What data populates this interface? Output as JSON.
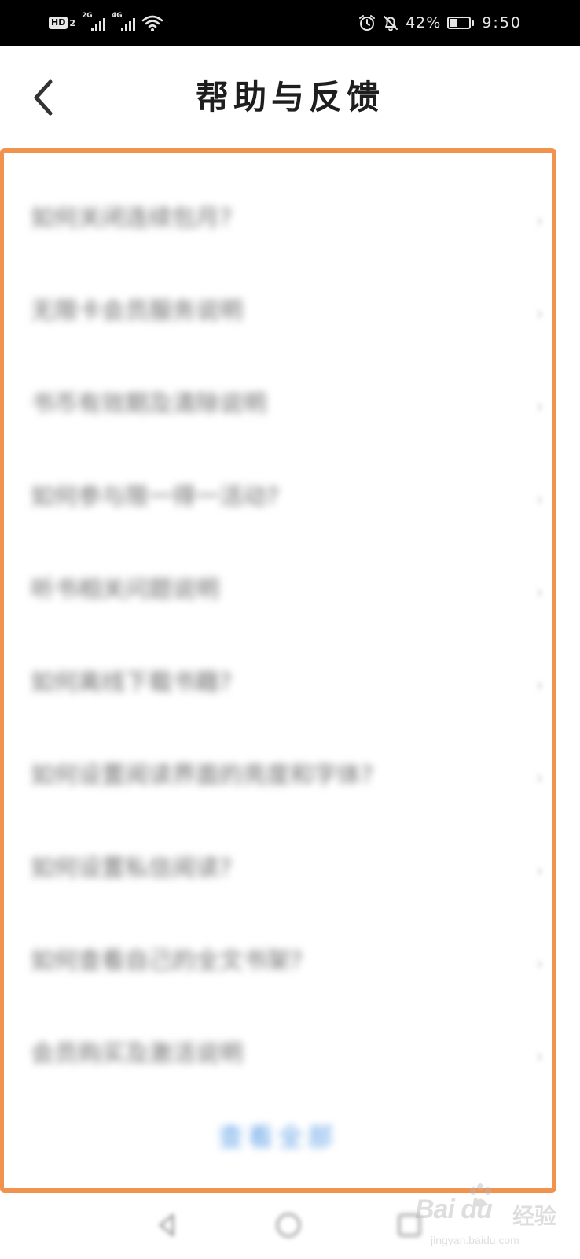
{
  "status_bar": {
    "hd_label": "HD",
    "hd_sub": "2",
    "sim1_generation": "2G",
    "sim2_generation": "4G",
    "battery_percent": "42%",
    "battery_level": 0.42,
    "time": "9:50",
    "icons": [
      "hd-icon",
      "signal-icon",
      "signal-icon",
      "wifi-icon",
      "alarm-icon",
      "bell-off-icon",
      "battery-icon"
    ]
  },
  "header": {
    "title": "帮助与反馈",
    "back_icon": "chevron-left-icon"
  },
  "faq": {
    "items": [
      {
        "label": "如何关闭连续包月?",
        "chevron": "›"
      },
      {
        "label": "无限卡会员服务说明",
        "chevron": "›"
      },
      {
        "label": "书币有效期及清除说明",
        "chevron": "›"
      },
      {
        "label": "如何参与限一得一活动?",
        "chevron": "›"
      },
      {
        "label": "听书相关问题说明",
        "chevron": "›"
      },
      {
        "label": "如何离线下载书籍?",
        "chevron": "›"
      },
      {
        "label": "如何设置阅读界面的亮度和字体?",
        "chevron": "›"
      },
      {
        "label": "如何设置私信阅读?",
        "chevron": "›"
      },
      {
        "label": "如何查看自己的全文书架?",
        "chevron": "›"
      },
      {
        "label": "会员购买及激活说明",
        "chevron": "›"
      }
    ],
    "more_label": "查看全部"
  },
  "bottom_nav": {
    "icons": [
      "nav-back-icon",
      "nav-home-icon",
      "nav-recent-icon"
    ]
  },
  "watermark": {
    "logo_text": "Bai du",
    "cn_text": "经验",
    "url": "jingyan.baidu.com"
  },
  "colors": {
    "highlight_border": "#f0934f",
    "link_blue": "#5b9ee6",
    "status_bar_bg": "#000000"
  }
}
